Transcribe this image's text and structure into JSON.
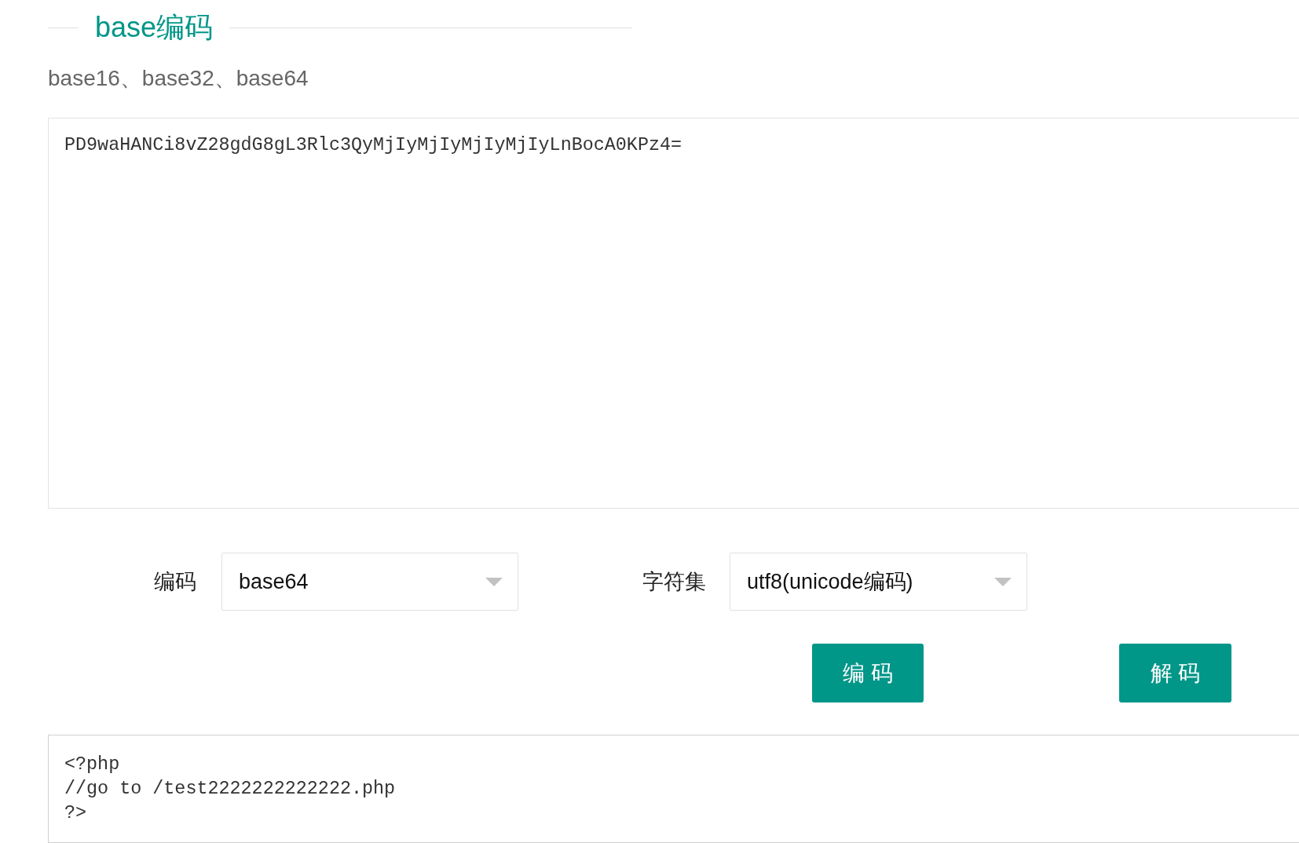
{
  "section": {
    "title": "base编码",
    "subtitle": "base16、base32、base64"
  },
  "input": {
    "value": "PD9waHANCi8vZ28gdG8gL3Rlc3QyMjIyMjIyMjIyMjIyLnBocA0KPz4="
  },
  "options": [
    {
      "label": "编码",
      "value": "base64"
    },
    {
      "label": "字符集",
      "value": "utf8(unicode编码)"
    }
  ],
  "buttons": [
    {
      "label": "编 码"
    },
    {
      "label": "解 码"
    }
  ],
  "output": {
    "value": "<?php\n//go to /test2222222222222.php\n?>"
  }
}
